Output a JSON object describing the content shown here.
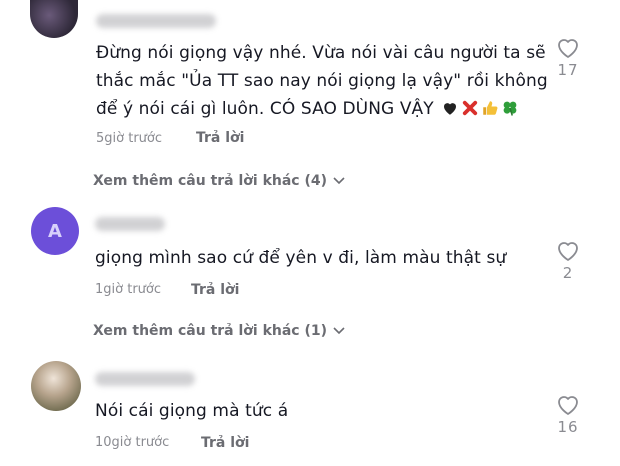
{
  "colors": {
    "text": "#161823",
    "muted": "#8a8b91",
    "reply": "#6b6c72",
    "avatar2": "#6c4fd9"
  },
  "comments": [
    {
      "lines": [
        "Đừng nói giọng vậy nhé. Vừa nói vài câu người ta sẽ",
        "thắc mắc \"Ủa TT sao nay nói giọng lạ vậy\" rồi không",
        "để ý nói cái gì luôn. CÓ SAO DÙNG VẬY"
      ],
      "emojis": [
        "black-heart-icon",
        "cross-mark-icon",
        "thumbs-up-icon",
        "four-leaf-clover-icon"
      ],
      "time": "5giờ trước",
      "reply": "Trả lời",
      "likes": "17",
      "more_replies": "Xem thêm câu trả lời khác (4)"
    },
    {
      "avatar_letter": "A",
      "lines": [
        "giọng mình sao cứ để yên v đi, làm màu thật sự"
      ],
      "time": "1giờ trước",
      "reply": "Trả lời",
      "likes": "2",
      "more_replies": "Xem thêm câu trả lời khác (1)"
    },
    {
      "lines": [
        "Nói cái giọng mà tức á"
      ],
      "time": "10giờ trước",
      "reply": "Trả lời",
      "likes": "16"
    }
  ]
}
